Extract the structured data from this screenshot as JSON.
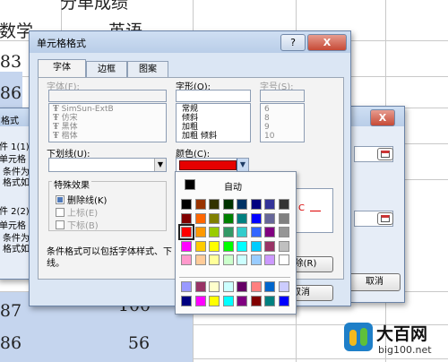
{
  "sheet": {
    "header_left": "数学",
    "header_right": "英语",
    "top_partial": "分单成绩",
    "r1": "83",
    "r2": "86",
    "r3_left": "87",
    "r3_right": "100",
    "r4_left": "86",
    "r4_right": "56"
  },
  "back_dialog": {
    "title_fragment": "格式",
    "cond1": "件 1(1)",
    "cond1_fmt": "单元格",
    "cond1_text": "条件为\n格式如",
    "cond2": "件 2(2)",
    "cond2_fmt": "单元格",
    "cond2_text": "条件为\n格式如"
  },
  "right_dialog": {
    "close_label": "X",
    "cancel_label": "取消"
  },
  "format_dialog": {
    "title": "单元格格式",
    "help_label": "?",
    "close_label": "X",
    "tabs": [
      "字体",
      "边框",
      "图案"
    ],
    "font_label": "字体(F):",
    "style_label": "字形(O):",
    "size_label": "字号(S):",
    "font_list": [
      "SimSun-ExtB",
      "仿宋",
      "黑体",
      "楷体"
    ],
    "style_list": [
      "常规",
      "倾斜",
      "加粗",
      "加粗 倾斜"
    ],
    "size_list": [
      "6",
      "8",
      "9",
      "10"
    ],
    "underline_label": "下划线(U):",
    "color_label": "颜色(C):",
    "effects_label": "特殊效果",
    "strikethrough": "删除线(K)",
    "superscript": "上标(E)",
    "subscript": "下标(B)",
    "note": "条件格式可以包括字体样式、下\n线。",
    "clear_label": "清除(R)",
    "cancel_label": "取消",
    "preview_text": "C"
  },
  "color_popup": {
    "auto_label": "自动",
    "accent": "#e60000",
    "rows": [
      [
        "#000000",
        "#993300",
        "#333300",
        "#003300",
        "#003366",
        "#000080",
        "#333399",
        "#333333"
      ],
      [
        "#800000",
        "#ff6600",
        "#808000",
        "#008000",
        "#008080",
        "#0000ff",
        "#666699",
        "#808080"
      ],
      [
        "#ff0000",
        "#ff9900",
        "#99cc00",
        "#339966",
        "#33cccc",
        "#3366ff",
        "#800080",
        "#969696"
      ],
      [
        "#ff00ff",
        "#ffcc00",
        "#ffff00",
        "#00ff00",
        "#00ffff",
        "#00ccff",
        "#993366",
        "#c0c0c0"
      ],
      [
        "#ff99cc",
        "#ffcc99",
        "#ffff99",
        "#ccffcc",
        "#ccffff",
        "#99ccff",
        "#cc99ff",
        "#ffffff"
      ]
    ],
    "extra_rows": [
      [
        "#9999ff",
        "#993366",
        "#ffffcc",
        "#ccffff",
        "#660066",
        "#ff8080",
        "#0066cc",
        "#ccccff"
      ],
      [
        "#000080",
        "#ff00ff",
        "#ffff00",
        "#00ffff",
        "#800080",
        "#800000",
        "#008080",
        "#0000ff"
      ]
    ],
    "selected": [
      2,
      0
    ]
  },
  "watermark": {
    "brand": "大百网",
    "url": "big100.net"
  }
}
